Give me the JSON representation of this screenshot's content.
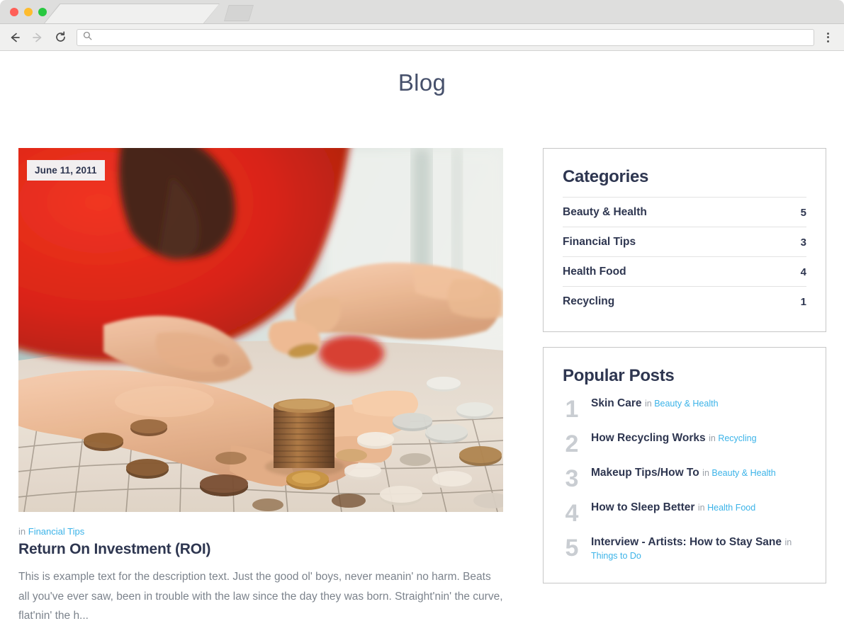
{
  "browser": {
    "tab_title": "",
    "address_value": "",
    "address_placeholder": "",
    "nav": {
      "back_label": "Back",
      "forward_label": "Forward",
      "reload_label": "Reload",
      "menu_label": "Customize and control"
    },
    "traffic_lights": {
      "close": "close",
      "minimize": "minimize",
      "zoom": "zoom"
    },
    "colors": {
      "close": "#ff5f57",
      "minimize": "#febc2e",
      "zoom": "#28c840",
      "chrome": "#dededd",
      "toolbar": "#f0f0ef"
    }
  },
  "page": {
    "title": "Blog",
    "colors": {
      "heading": "#46506b",
      "text_dark": "#2e3650",
      "text_muted": "#7c838c",
      "link": "#3bb3e8",
      "rank": "#c9cdd2",
      "card_border": "#c7c7c7"
    }
  },
  "post": {
    "date": "June 11, 2011",
    "in_label": "in",
    "category": "Financial Tips",
    "title": "Return On Investment (ROI)",
    "excerpt": "This is example text for the description text. Just the good ol' boys, never meanin' no harm. Beats all you've ever saw, been in trouble with the law since the day they was born. Straight'nin' the curve, flat'nin' the h...",
    "image_alt": "two people counting coins on a striped cloth"
  },
  "sidebar": {
    "categories": {
      "title": "Categories",
      "items": [
        {
          "label": "Beauty & Health",
          "count": "5"
        },
        {
          "label": "Financial Tips",
          "count": "3"
        },
        {
          "label": "Health Food",
          "count": "4"
        },
        {
          "label": "Recycling",
          "count": "1"
        }
      ]
    },
    "popular_posts": {
      "title": "Popular Posts",
      "in_label": "in",
      "items": [
        {
          "rank": "1",
          "title": "Skin Care",
          "category": "Beauty & Health"
        },
        {
          "rank": "2",
          "title": "How Recycling Works",
          "category": "Recycling"
        },
        {
          "rank": "3",
          "title": "Makeup Tips/How To",
          "category": "Beauty & Health"
        },
        {
          "rank": "4",
          "title": "How to Sleep Better",
          "category": "Health Food"
        },
        {
          "rank": "5",
          "title": "Interview - Artists: How to Stay Sane",
          "category": "Things to Do"
        }
      ]
    }
  }
}
